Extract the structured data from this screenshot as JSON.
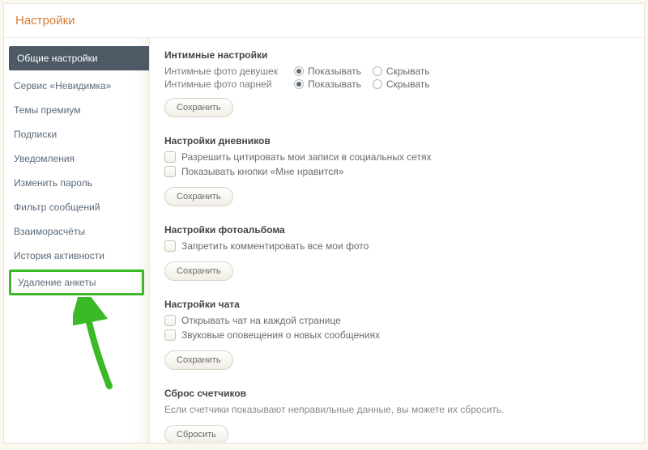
{
  "page_title": "Настройки",
  "sidebar": {
    "items": [
      {
        "label": "Общие настройки",
        "active": true
      },
      {
        "label": "Сервис «Невидимка»"
      },
      {
        "label": "Темы премиум"
      },
      {
        "label": "Подписки"
      },
      {
        "label": "Уведомления"
      },
      {
        "label": "Изменить пароль"
      },
      {
        "label": "Фильтр сообщений"
      },
      {
        "label": "Взаиморасчёты"
      },
      {
        "label": "История активности"
      },
      {
        "label": "Удаление анкеты",
        "highlighted": true
      }
    ]
  },
  "sections": {
    "intimate": {
      "title": "Интимные настройки",
      "rows": [
        {
          "label": "Интимные фото девушек"
        },
        {
          "label": "Интимные фото парней"
        }
      ],
      "radio_options": {
        "show": "Показывать",
        "hide": "Скрывать"
      },
      "save": "Сохранить"
    },
    "diaries": {
      "title": "Настройки дневников",
      "checks": [
        "Разрешить цитировать мои записи в социальных сетях",
        "Показывать кнопки «Мне нравится»"
      ],
      "save": "Сохранить"
    },
    "album": {
      "title": "Настройки фотоальбома",
      "checks": [
        "Запретить комментировать все мои фото"
      ],
      "save": "Сохранить"
    },
    "chat": {
      "title": "Настройки чата",
      "checks": [
        "Открывать чат на каждой странице",
        "Звуковые оповещения о новых сообщениях"
      ],
      "save": "Сохранить"
    },
    "counters": {
      "title": "Сброс счетчиков",
      "desc": "Если счетчики показывают неправильные данные, вы можете их сбросить.",
      "reset": "Сбросить"
    }
  }
}
